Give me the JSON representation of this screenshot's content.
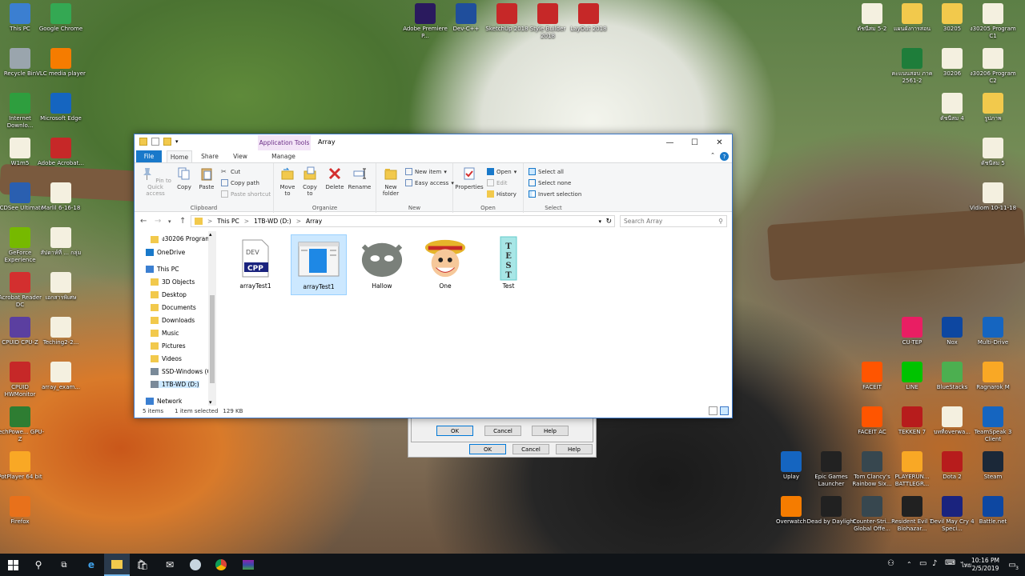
{
  "desktop": {
    "icons_left": [
      {
        "label": "This PC",
        "color": "#3b7fd1"
      },
      {
        "label": "Recycle Bin",
        "color": "#9aa5ad"
      },
      {
        "label": "Internet Downlo...",
        "color": "#2e9e3e"
      },
      {
        "label": "W1m5",
        "color": "#f4f0e0"
      },
      {
        "label": "ACDSee Ultimate",
        "color": "#2a5fb0"
      },
      {
        "label": "GeForce Experience",
        "color": "#76b900"
      },
      {
        "label": "Acrobat Reader DC",
        "color": "#d32f2f"
      },
      {
        "label": "CPUID CPU-Z",
        "color": "#5b3fa0"
      },
      {
        "label": "CPUID HWMonitor",
        "color": "#c62828"
      },
      {
        "label": "TechPowe... GPU-Z",
        "color": "#2e7d32"
      },
      {
        "label": "PotPlayer 64 bit",
        "color": "#f9a825"
      },
      {
        "label": "Firefox",
        "color": "#e8711b"
      }
    ],
    "icons_left2": [
      {
        "label": "Google Chrome",
        "color": "#34a853"
      },
      {
        "label": "VLC media player",
        "color": "#f57c00"
      },
      {
        "label": "Microsoft Edge",
        "color": "#1565c0"
      },
      {
        "label": "Adobe Acrobat...",
        "color": "#c62828"
      },
      {
        "label": "Marlil 6-16-18",
        "color": "#f4f0e0"
      },
      {
        "label": "สัปดาห์ที่ ... กลุ่ม",
        "color": "#f4f0e0"
      },
      {
        "label": "เอกสารพิเศษ",
        "color": "#f4f0e0"
      },
      {
        "label": "Teching2-2...",
        "color": "#f4f0e0"
      },
      {
        "label": "array_exam...",
        "color": "#f4f0e0"
      }
    ],
    "icons_top": [
      {
        "label": "Adobe Premiere P...",
        "color": "#2a1a5e"
      },
      {
        "label": "Dev-C++",
        "color": "#1f4e9c"
      },
      {
        "label": "SketchUp 2018",
        "color": "#c62828"
      },
      {
        "label": "Style Builder 2018",
        "color": "#c62828"
      },
      {
        "label": "LayOut 2018",
        "color": "#c62828"
      }
    ],
    "icons_right": [
      {
        "label": "ดัชนีสม 5-2",
        "color": "#f4f0e0"
      },
      {
        "label": "แผนผังการสอน",
        "color": "#f2c94c"
      },
      {
        "label": "30205",
        "color": "#f2c94c"
      },
      {
        "label": "ง30205 Program C1",
        "color": "#f4f0e0"
      },
      {
        "label": "คะแนนสอบ ภาค 2561-2",
        "color": "#1e7d3a"
      },
      {
        "label": "30206",
        "color": "#f4f0e0"
      },
      {
        "label": "ง30206 Program C2",
        "color": "#f4f0e0"
      },
      {
        "label": "ดัชนีสม 4",
        "color": "#f4f0e0"
      },
      {
        "label": "รูปภาพ",
        "color": "#f2c94c"
      },
      {
        "label": "ดัชนีสม 5",
        "color": "#f4f0e0"
      },
      {
        "label": "Vidiom 10-11-18",
        "color": "#f4f0e0"
      },
      {
        "label": "CU-TEP",
        "color": "#e91e63"
      },
      {
        "label": "Nox",
        "color": "#0d47a1"
      },
      {
        "label": "Multi-Drive",
        "color": "#1565c0"
      },
      {
        "label": "FACEIT",
        "color": "#ff5500"
      },
      {
        "label": "LINE",
        "color": "#00c300"
      },
      {
        "label": "BlueStacks",
        "color": "#4caf50"
      },
      {
        "label": "Ragnarok M",
        "color": "#f9a825"
      },
      {
        "label": "FACEIT AC",
        "color": "#ff5500"
      },
      {
        "label": "TEKKEN 7",
        "color": "#b71c1c"
      },
      {
        "label": "บทที่overwa...",
        "color": "#f4f0e0"
      },
      {
        "label": "TeamSpeak 3 Client",
        "color": "#1565c0"
      },
      {
        "label": "Uplay",
        "color": "#1565c0"
      },
      {
        "label": "Epic Games Launcher",
        "color": "#222222"
      },
      {
        "label": "Tom Clancy's Rainbow Six...",
        "color": "#37474f"
      },
      {
        "label": "PLAYERUN... BATTLEGR...",
        "color": "#f9a825"
      },
      {
        "label": "Dota 2",
        "color": "#b71c1c"
      },
      {
        "label": "Steam",
        "color": "#1b2838"
      },
      {
        "label": "Overwatch",
        "color": "#f57c00"
      },
      {
        "label": "Dead by Daylight",
        "color": "#212121"
      },
      {
        "label": "Counter-Stri... Global Offe...",
        "color": "#37474f"
      },
      {
        "label": "Resident Evil 7 Biohazar...",
        "color": "#212121"
      },
      {
        "label": "Devil May Cry 4 Speci...",
        "color": "#1a237e"
      },
      {
        "label": "Battle.net",
        "color": "#0d47a1"
      }
    ]
  },
  "explorer": {
    "title": "Array",
    "context_tab": "Application Tools",
    "tabs": {
      "file": "File",
      "home": "Home",
      "share": "Share",
      "view": "View",
      "manage": "Manage"
    },
    "ribbon": {
      "clipboard": {
        "group": "Clipboard",
        "pin": "Pin to Quick access",
        "copy": "Copy",
        "paste": "Paste",
        "cut": "Cut",
        "copy_path": "Copy path",
        "paste_shortcut": "Paste shortcut"
      },
      "organize": {
        "group": "Organize",
        "move_to": "Move to",
        "copy_to": "Copy to",
        "delete": "Delete",
        "rename": "Rename"
      },
      "new": {
        "group": "New",
        "new_folder": "New folder",
        "new_item": "New item",
        "easy_access": "Easy access"
      },
      "open": {
        "group": "Open",
        "properties": "Properties",
        "open": "Open",
        "edit": "Edit",
        "history": "History"
      },
      "select": {
        "group": "Select",
        "select_all": "Select all",
        "select_none": "Select none",
        "invert": "Invert selection"
      }
    },
    "address": {
      "parts": [
        "This PC",
        "1TB-WD (D:)",
        "Array"
      ],
      "separator": ">"
    },
    "search_placeholder": "Search Array",
    "nav": {
      "items": [
        {
          "label": "ง30206 Program",
          "kind": "folder"
        },
        {
          "label": "OneDrive",
          "kind": "cloud"
        },
        {
          "label": "This PC",
          "kind": "pc"
        },
        {
          "label": "3D Objects",
          "kind": "folder"
        },
        {
          "label": "Desktop",
          "kind": "folder"
        },
        {
          "label": "Documents",
          "kind": "folder"
        },
        {
          "label": "Downloads",
          "kind": "folder"
        },
        {
          "label": "Music",
          "kind": "folder"
        },
        {
          "label": "Pictures",
          "kind": "folder"
        },
        {
          "label": "Videos",
          "kind": "folder"
        },
        {
          "label": "SSD-Windows (C",
          "kind": "drive"
        },
        {
          "label": "1TB-WD (D:)",
          "kind": "drive"
        },
        {
          "label": "Network",
          "kind": "network"
        }
      ]
    },
    "files": [
      {
        "name": "arrayTest1",
        "kind": "cpp",
        "badge": "CPP",
        "badge_top": "DEV"
      },
      {
        "name": "arrayTest1",
        "kind": "exe"
      },
      {
        "name": "Hallow",
        "kind": "hallow"
      },
      {
        "name": "One",
        "kind": "one"
      },
      {
        "name": "Test",
        "kind": "test",
        "text": "TEST"
      }
    ],
    "status": {
      "count": "5 items",
      "selected": "1 item selected",
      "size": "129 KB"
    }
  },
  "dialogs": {
    "front": {
      "ok": "OK",
      "cancel": "Cancel",
      "help": "Help"
    },
    "back": {
      "ok": "OK",
      "cancel": "Cancel",
      "help": "Help"
    }
  },
  "taskbar": {
    "time": "10:16 PM",
    "date": "2/5/2019",
    "lang": "ไทย",
    "notif_count": "3"
  }
}
